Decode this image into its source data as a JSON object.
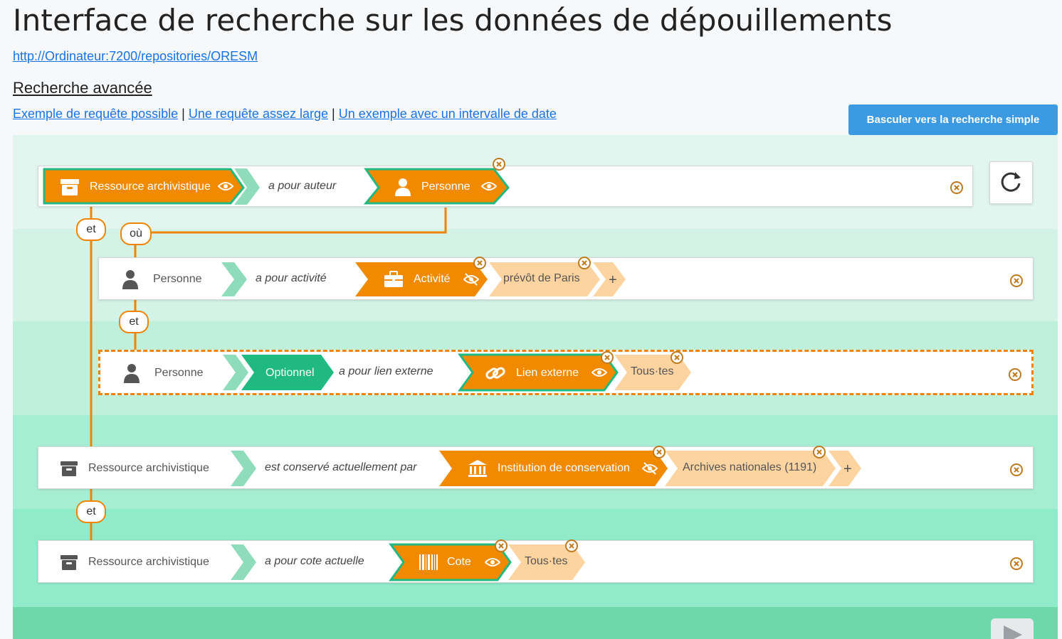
{
  "page": {
    "title": "Interface de recherche sur les données de dépouillements",
    "endpoint": "http://Ordinateur:7200/repositories/ORESM",
    "section_title": "Recherche avancée",
    "examples": [
      "Exemple de requête possible",
      "Une requête assez large",
      "Un exemple avec un intervalle de date"
    ],
    "separator": "|",
    "toggle_button": "Basculer vers la recherche simple"
  },
  "connectors": {
    "et": "et",
    "ou": "où"
  },
  "rows": [
    {
      "subject": "Ressource archivistique",
      "predicate": "a pour auteur",
      "object": "Personne"
    },
    {
      "subject": "Personne",
      "predicate": "a pour activité",
      "object": "Activité",
      "value": "prévôt de Paris"
    },
    {
      "subject": "Personne",
      "optional": "Optionnel",
      "predicate": "a pour lien externe",
      "object": "Lien externe",
      "value": "Tous·tes"
    },
    {
      "subject": "Ressource archivistique",
      "predicate": "est conservé actuellement par",
      "object": "Institution de conservation",
      "value": "Archives nationales (1191)"
    },
    {
      "subject": "Ressource archivistique",
      "predicate": "a pour cote actuelle",
      "object": "Cote",
      "value": "Tous·tes"
    }
  ],
  "add_value": "+",
  "colors": {
    "orange": "#f28a00",
    "orange_light": "#fdd3a0",
    "green": "#1fb981",
    "green_chevron": "#8fdcbb",
    "link": "#1a73e8",
    "button_blue": "#3b9ae1",
    "connector_line": "#f08400"
  },
  "icons": {
    "resource": "archive-box-icon",
    "person": "person-icon",
    "activity": "briefcase-icon",
    "link": "link-icon",
    "institution": "bank-building-icon",
    "cote": "barcode-icon",
    "visible": "eye-icon",
    "hidden": "eye-slash-icon",
    "remove": "close-circle-icon",
    "reset": "refresh-icon",
    "submit": "play-icon"
  }
}
